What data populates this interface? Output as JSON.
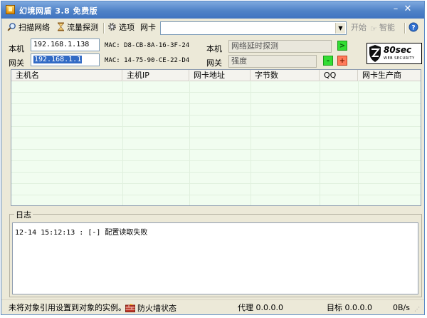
{
  "window": {
    "title": "幻境网盾 3.8 免费版"
  },
  "toolbar": {
    "scan_label": "扫描网络",
    "traffic_label": "流量探测",
    "options_label": "选项",
    "nic_label": "网卡",
    "nic_value": "",
    "start_label": "开始",
    "smart_label": "智能"
  },
  "local": {
    "label": "本机",
    "ip": "192.168.1.138",
    "mac": "MAC: D8-CB-8A-16-3F-24",
    "probe_label": "本机",
    "probe_value": "网络延时探测",
    "probe_btn": ">"
  },
  "gateway": {
    "label": "网关",
    "ip": "192.168.1.1",
    "mac": "MAC: 14-75-90-CE-22-D4",
    "strength_label": "网关",
    "strength_value": "强度",
    "minus": "-",
    "plus": "+"
  },
  "logo": {
    "text": "80sec",
    "sub": "WEB SECURITY"
  },
  "table": {
    "columns": [
      "主机名",
      "主机IP",
      "网卡地址",
      "字节数",
      "QQ",
      "网卡生产商"
    ],
    "rows": []
  },
  "log": {
    "title": "日志",
    "lines": [
      "12-14 15:12:13 : [-] 配置读取失败"
    ]
  },
  "status": {
    "message": "未将对象引用设置到对象的实例。",
    "firewall": "防火墙状态",
    "proxy": "代理 0.0.0.0",
    "target": "目标 0.0.0.0",
    "speed": "0B/s"
  },
  "colors": {
    "title_bar": "#4f82c7",
    "table_bg": "#f1fdf0",
    "go_button": "#33dd33",
    "plus_button": "#ff7a5a",
    "selection": "#316ac5"
  }
}
